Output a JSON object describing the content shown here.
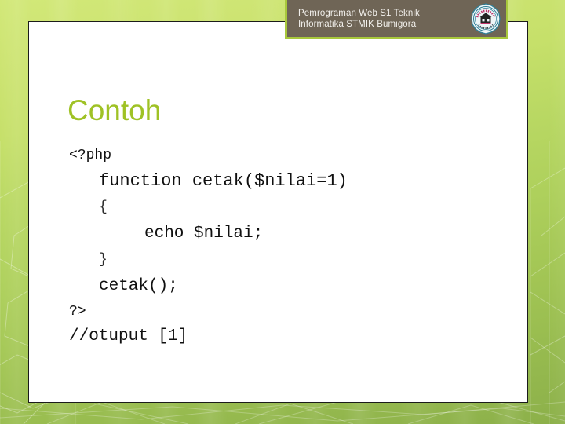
{
  "header": {
    "title": "Pemrograman Web S1 Teknik\nInformatika STMIK Bumigora",
    "logo_icon": "university-seal-icon",
    "background_color": "#6f6556",
    "border_color": "#a8c83c",
    "text_color": "#f2f0ec"
  },
  "slide": {
    "title": "Contoh",
    "title_color": "#9fc225",
    "background_gradient_from": "#d2e878",
    "background_gradient_to": "#8cb04a",
    "panel_background": "#ffffff",
    "panel_border_color": "#1b1b1b"
  },
  "code": {
    "language": "php",
    "lines": [
      {
        "text": "<?php",
        "size": "sm",
        "indent": 0
      },
      {
        "text": "function cetak($nilai=1)",
        "size": "lg",
        "indent": 1
      },
      {
        "text": "{",
        "size": "brace",
        "indent": 1
      },
      {
        "text": "echo $nilai;",
        "size": "md",
        "indent": 2
      },
      {
        "text": "}",
        "size": "brace",
        "indent": 1
      },
      {
        "text": "cetak();",
        "size": "md",
        "indent": 1
      },
      {
        "text": "?>",
        "size": "sm",
        "indent": 0
      },
      {
        "text": "//otuput [1]",
        "size": "md",
        "indent": 0
      }
    ]
  }
}
